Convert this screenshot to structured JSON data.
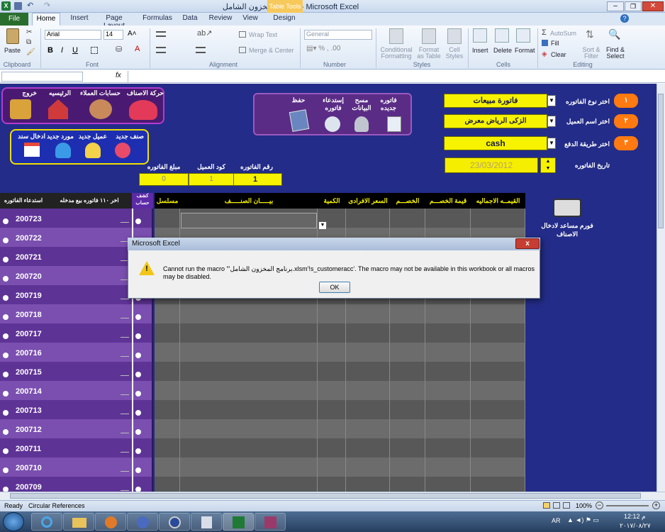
{
  "window": {
    "title": "برنامج المخزون الشامل - Microsoft Excel",
    "context_tab": "Table Tools"
  },
  "ribbon_tabs": [
    "File",
    "Home",
    "Insert",
    "Page Layout",
    "Formulas",
    "Data",
    "Review",
    "View",
    "Design"
  ],
  "ribbon": {
    "clipboard": {
      "paste": "Paste",
      "label": "Clipboard"
    },
    "font": {
      "name": "Arial",
      "size": "14",
      "bold": "B",
      "italic": "I",
      "underline": "U",
      "label": "Font"
    },
    "alignment": {
      "wrap": "Wrap Text",
      "merge": "Merge & Center",
      "label": "Alignment"
    },
    "number": {
      "format": "General",
      "label": "Number"
    },
    "styles": {
      "cond": "Conditional Formatting",
      "table": "Format as Table",
      "cell": "Cell Styles",
      "label": "Styles"
    },
    "cells": {
      "insert": "Insert",
      "delete": "Delete",
      "format": "Format",
      "label": "Cells"
    },
    "editing": {
      "autosum": "AutoSum",
      "fill": "Fill",
      "clear": "Clear",
      "sort": "Sort & Filter",
      "find": "Find & Select",
      "label": "Editing"
    }
  },
  "formula_bar": {
    "fx": "fx"
  },
  "nav_panel": {
    "items": [
      "حركة الاصناف",
      "حسابات العملاء",
      "الرئيسيه",
      "خروج"
    ]
  },
  "add_panel": {
    "items": [
      "صنف جديد",
      "عميل جديد",
      "مورد جديد",
      "ادخال سند"
    ]
  },
  "actions_panel": {
    "items": [
      "فاتوره جديده",
      "مسح البيانات",
      "إستدعاء فاتوره",
      "حفظ"
    ]
  },
  "form": {
    "invoice_type_label": "اختر نوع الفاتوره",
    "invoice_type": "فاتورة مبيعات",
    "step1": "١",
    "customer_label": "اختر اسم العميل",
    "customer": "الزكى الرياض   معرض",
    "step2": "٢",
    "payment_label": "اختر طريقة الدفع",
    "payment": "cash",
    "step3": "٣",
    "date_label": "تاريخ الفاتوره",
    "date": "23/03/2012"
  },
  "summary": {
    "invoice_no_label": "رقم الفاتوره",
    "invoice_no": "1",
    "customer_code_label": "كود العميل",
    "customer_code": "1",
    "amount_label": "مبلغ الفاتوره",
    "amount": "0"
  },
  "left_list": {
    "header_recall": "استدعاء الفاتوره",
    "header_last": "اخر ١١٠ فاتوره بيع مدخله",
    "header_statement": "كشف حساب",
    "invoices": [
      "200723",
      "200722",
      "200721",
      "200720",
      "200719",
      "200718",
      "200717",
      "200716",
      "200715",
      "200714",
      "200713",
      "200712",
      "200711",
      "200710",
      "200709"
    ]
  },
  "grid_headers": {
    "serial": "مسلسل",
    "item": "بيـــــان الصنـــــف",
    "qty": "الكمية",
    "price": "السعر الافرادى",
    "discount": "الخصـــم",
    "discount_value": "قيمة الخصـــم",
    "total": "القيمــه الاجماليه"
  },
  "helper": {
    "label": "فورم مساعد لادخال الاصناف"
  },
  "dialog": {
    "title": "Microsoft Excel",
    "message": "Cannot run the macro \"'برنامج المخزون الشامل.xlsm'!s_customeracc'. The macro may not be available in this workbook or all macros may be disabled.",
    "ok": "OK",
    "close": "x"
  },
  "status": {
    "ready": "Ready",
    "circular": "Circular References",
    "zoom": "100%"
  },
  "taskbar": {
    "lang": "AR",
    "time": "12:12 م",
    "date": "٢٠١٧/٠٨/٢٧"
  },
  "colors": {
    "sheet_bg": "#232c88",
    "header_yellow": "#f4f100",
    "purple_list": "#6a3fa0",
    "dialog_bg": "#f0f0f0"
  }
}
